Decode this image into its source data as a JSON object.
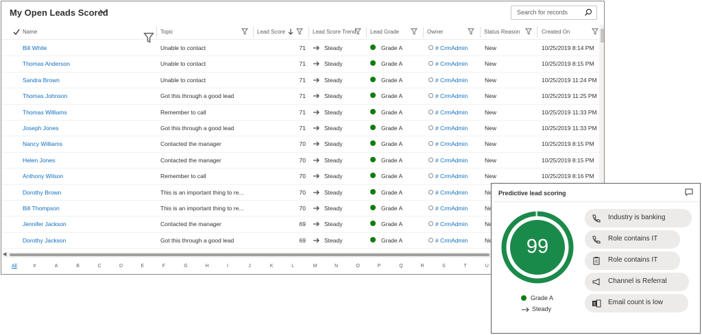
{
  "view": {
    "title": "My Open Leads Scored",
    "search_placeholder": "Search for records"
  },
  "columns": {
    "name": "Name",
    "topic": "Topic",
    "lead_score": "Lead Score",
    "lead_score_trend": "Lead Score Trend",
    "lead_grade": "Lead Grade",
    "owner": "Owner",
    "status_reason": "Status Reason",
    "created_on": "Created On"
  },
  "rows": [
    {
      "name": "Bill White",
      "topic": "Unable to contact",
      "score": "71",
      "trend": "Steady",
      "grade": "Grade A",
      "owner": "# CrmAdmin",
      "status": "New",
      "created": "10/25/2019 8:14 PM"
    },
    {
      "name": "Thomas Anderson",
      "topic": "Unable to contact",
      "score": "71",
      "trend": "Steady",
      "grade": "Grade A",
      "owner": "# CrmAdmin",
      "status": "New",
      "created": "10/25/2019 8:15 PM"
    },
    {
      "name": "Sandra Brown",
      "topic": "Unable to contact",
      "score": "71",
      "trend": "Steady",
      "grade": "Grade A",
      "owner": "# CrmAdmin",
      "status": "New",
      "created": "10/25/2019 11:24 PM"
    },
    {
      "name": "Thomas Johnson",
      "topic": "Got this through a good lead",
      "score": "71",
      "trend": "Steady",
      "grade": "Grade A",
      "owner": "# CrmAdmin",
      "status": "New",
      "created": "10/25/2019 11:25 PM"
    },
    {
      "name": "Thomas Williams",
      "topic": "Remember to call",
      "score": "71",
      "trend": "Steady",
      "grade": "Grade A",
      "owner": "# CrmAdmin",
      "status": "New",
      "created": "10/25/2019 11:33 PM"
    },
    {
      "name": "Joseph Jones",
      "topic": "Got this through a good lead",
      "score": "71",
      "trend": "Steady",
      "grade": "Grade A",
      "owner": "# CrmAdmin",
      "status": "New",
      "created": "10/25/2019 11:33 PM"
    },
    {
      "name": "Nancy Williams",
      "topic": "Contacted the manager",
      "score": "70",
      "trend": "Steady",
      "grade": "Grade A",
      "owner": "# CrmAdmin",
      "status": "New",
      "created": "10/25/2019 8:15 PM"
    },
    {
      "name": "Helen Jones",
      "topic": "Contacted the manager",
      "score": "70",
      "trend": "Steady",
      "grade": "Grade A",
      "owner": "# CrmAdmin",
      "status": "New",
      "created": "10/25/2019 8:15 PM"
    },
    {
      "name": "Anthony Wilson",
      "topic": "Remember to call",
      "score": "70",
      "trend": "Steady",
      "grade": "Grade A",
      "owner": "# CrmAdmin",
      "status": "New",
      "created": "10/25/2019 8:16 PM"
    },
    {
      "name": "Dorothy Brown",
      "topic": "This is an important thing to re...",
      "score": "70",
      "trend": "Steady",
      "grade": "Grade A",
      "owner": "# CrmAdmin",
      "status": "Ne",
      "created": ""
    },
    {
      "name": "Bill Thompson",
      "topic": "This is an important thing to re...",
      "score": "70",
      "trend": "Steady",
      "grade": "Grade A",
      "owner": "# CrmAdmin",
      "status": "Ne",
      "created": ""
    },
    {
      "name": "Jennifer Jackson",
      "topic": "Contacted the manager",
      "score": "69",
      "trend": "Steady",
      "grade": "Grade A",
      "owner": "# CrmAdmin",
      "status": "Ne",
      "created": ""
    },
    {
      "name": "Dorothy Jackson",
      "topic": "Got this through a good lead",
      "score": "69",
      "trend": "Steady",
      "grade": "Grade A",
      "owner": "# CrmAdmin",
      "status": "Ne",
      "created": ""
    }
  ],
  "jump_bar": [
    "All",
    "#",
    "A",
    "B",
    "C",
    "D",
    "E",
    "F",
    "G",
    "H",
    "I",
    "J",
    "K",
    "L",
    "M",
    "N",
    "O",
    "P",
    "Q",
    "R",
    "S",
    "T",
    "U"
  ],
  "scoring_card": {
    "title": "Predictive lead scoring",
    "score": "99",
    "score_fraction": 0.99,
    "grade": "Grade A",
    "trend": "Steady",
    "factors": [
      "Industry is banking",
      "Role contains IT",
      "Role contains IT",
      "Channel is Referral",
      "Email count is low"
    ]
  },
  "colors": {
    "link": "#106ebe",
    "grade_a": "#107c10",
    "score_ring": "#1a8a4a"
  },
  "icons": {
    "view_switcher": "chevron-down-icon",
    "search": "search-icon",
    "column_filter": "filter-icon",
    "sort": "sort-descending-icon",
    "trend": "arrow-right-icon",
    "owner": "user-presence-icon",
    "comment": "comment-icon",
    "factors": [
      "phone-icon",
      "phone-icon",
      "clipboard-icon",
      "megaphone-icon",
      "email-icon"
    ]
  }
}
